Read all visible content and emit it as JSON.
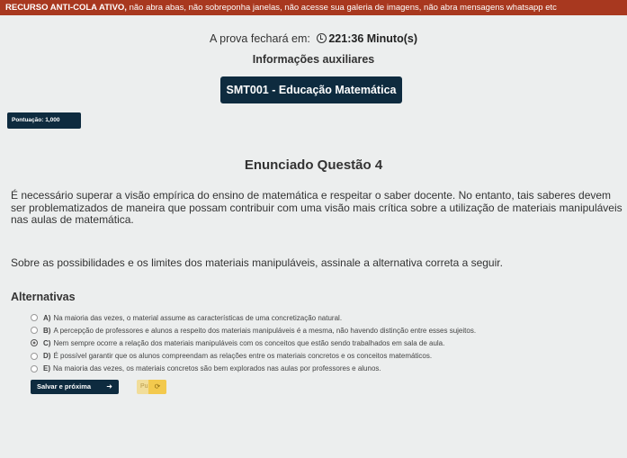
{
  "warning": {
    "prefix": "RECURSO ANTI-COLA ATIVO,",
    "text": " não abra abas, não sobreponha janelas, não acesse sua galeria de imagens, não abra mensagens whatsapp etc"
  },
  "timer": {
    "label": "A prova fechará em:",
    "icon": "clock-icon",
    "value": "221:36 Minuto(s)"
  },
  "aux_info_label": "Informações auxiliares",
  "subject_label": "SMT001 - Educação Matemática",
  "score_label": "Pontuação: 1,000",
  "question": {
    "title": "Enunciado Questão 4",
    "stem": "É necessário superar a visão empírica do ensino de matemática e respeitar o saber docente. No entanto, tais saberes devem ser problematizados de maneira que possam contribuir com uma visão mais crítica sobre a utilização de materiais manipuláveis nas aulas de matemática.",
    "prompt": "Sobre as possibilidades e os limites dos materiais manipuláveis, assinale a alternativa correta a seguir."
  },
  "alternatives_title": "Alternativas",
  "options": [
    {
      "letter": "A)",
      "text": "Na maioria das vezes, o material assume as características de uma concretização natural.",
      "selected": false
    },
    {
      "letter": "B)",
      "text": "A percepção de professores e alunos a respeito dos materiais manipuláveis é a mesma, não havendo distinção entre esses sujeitos.",
      "selected": false
    },
    {
      "letter": "C)",
      "text": "Nem sempre ocorre a relação dos materiais manipuláveis com os conceitos que estão sendo trabalhados em sala de aula.",
      "selected": true
    },
    {
      "letter": "D)",
      "text": "É possível garantir que os alunos compreendam as relações entre os materiais concretos e os conceitos matemáticos.",
      "selected": false
    },
    {
      "letter": "E)",
      "text": "Na maioria das vezes, os materiais concretos são bem explorados nas aulas por professores e alunos.",
      "selected": false
    }
  ],
  "buttons": {
    "save_next": "Salvar e próxima",
    "save_icon": "arrow-right-icon",
    "skip": "Pular",
    "skip_icon": "skip-icon"
  },
  "colors": {
    "warning_bg": "#a8381f",
    "primary": "#0e2b3f",
    "skip_bg": "#f1dd9a",
    "skip_icon_bg": "#f3c94d"
  }
}
